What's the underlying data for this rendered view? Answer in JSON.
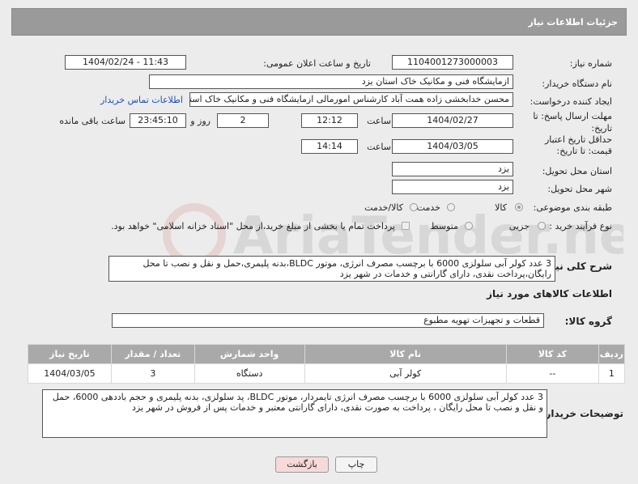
{
  "panel": {
    "title": "جزئیات اطلاعات نیاز"
  },
  "form": {
    "need_number_label": "شماره نیاز:",
    "need_number": "1104001273000003",
    "announce_label": "تاریخ و ساعت اعلان عمومی:",
    "announce_value": "1404/02/24 - 11:43",
    "buyer_label": "نام دستگاه خریدار:",
    "buyer_value": "ازمایشگاه فنی و مکانیک خاک استان یزد",
    "creator_label": "ایجاد کننده درخواست:",
    "creator_value": "محسن خدابخشی زاده همت آباد کارشناس امورمالی ازمایشگاه فنی و مکانیک خاک استان یزد",
    "contact_link": "اطلاعات تماس خریدار",
    "deadline_label": "مهلت ارسال پاسخ: تا تاریخ:",
    "deadline_date": "1404/02/27",
    "time_label": "ساعت",
    "deadline_time": "12:12",
    "days_value": "2",
    "days_label": "روز و",
    "remaining_time": "23:45:10",
    "remaining_label": "ساعت باقی مانده",
    "price_valid_label": "حداقل تاریخ اعتبار قیمت: تا تاریخ:",
    "price_valid_date": "1404/03/05",
    "price_valid_time": "14:14",
    "province_label": "استان محل تحویل:",
    "province_value": "یزد",
    "city_label": "شهر محل تحویل:",
    "city_value": "یزد",
    "category_label": "طبقه بندی موضوعی:",
    "category_options": [
      "کالا",
      "خدمت",
      "کالا/خدمت"
    ],
    "process_label": "نوع فرآیند خرید :",
    "process_options": [
      "جزیی",
      "متوسط"
    ],
    "payment_note": "پرداخت تمام یا بخشی از مبلغ خرید،از محل \"اسناد خزانه اسلامی\" خواهد بود.",
    "description_label": "شرح کلی نیاز:",
    "description_value": "3 عدد کولر آبی سلولزی 6000 با برچسب مصرف انرژی، موتور BLDC،بدنه پلیمری،حمل و نقل و نصب تا محل رایگان،پرداخت نقدی، دارای گارانتی و خدمات در شهر یزد"
  },
  "goods": {
    "section_title": "اطلاعات کالاهای مورد نیاز",
    "group_label": "گروه کالا:",
    "group_value": "قطعات و تجهیزات تهویه مطبوع",
    "headers": [
      "ردیف",
      "کد کالا",
      "نام کالا",
      "واحد شمارش",
      "تعداد / مقدار",
      "تاریخ نیاز"
    ],
    "rows": [
      [
        "1",
        "--",
        "کولر آبی",
        "دستگاه",
        "3",
        "1404/03/05"
      ]
    ]
  },
  "buyer_notes": {
    "label": "توضیحات خریدار:",
    "value": "3 عدد کولر آبی سلولزی 6000 با برچسب مصرف انرژی تایمردار، موتور BLDC، پد سلولزی، بدنه پلیمری و حجم باددهی 6000، حمل و نقل و نصب تا محل رایگان ، پرداخت به صورت نقدی، دارای گارانتی معتبر و خدمات پس از فروش در شهر یزد"
  },
  "buttons": {
    "print": "چاپ",
    "back": "بازگشت"
  },
  "watermark": {
    "text": "AriaTender.net"
  },
  "colors": {
    "header_bg": "#9a9a9a",
    "link": "#1a4fc4",
    "back_bg": "#f7d9d9"
  }
}
